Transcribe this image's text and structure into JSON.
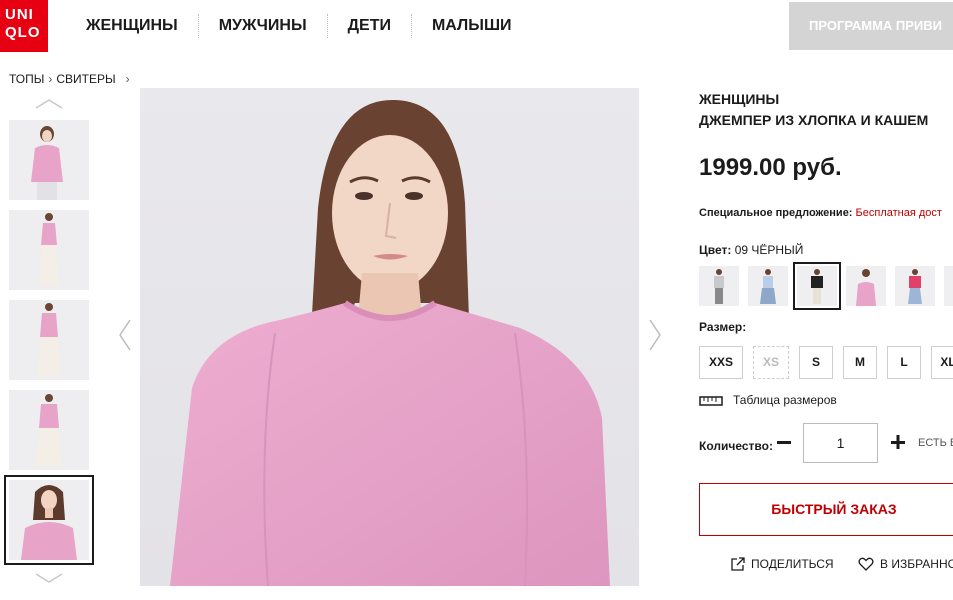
{
  "logo": {
    "line1": "UNI",
    "line2": "QLO",
    "color": "#e60012"
  },
  "nav": {
    "items": [
      "ЖЕНЩИНЫ",
      "МУЖЧИНЫ",
      "ДЕТИ",
      "МАЛЫШИ"
    ]
  },
  "promo": {
    "label": "ПРОГРАММА ПРИВИ"
  },
  "breadcrumb": {
    "items": [
      "ТОПЫ",
      "СВИТЕРЫ"
    ]
  },
  "thumbnails": {
    "count": 5,
    "selected_index": 4
  },
  "product": {
    "category": "ЖЕНЩИНЫ",
    "name": "ДЖЕМПЕР ИЗ ХЛОПКА И КАШЕМ",
    "price": "1999.00 руб.",
    "special_label": "Специальное предложение:",
    "special_value": "Бесплатная дост",
    "color_label": "Цвет:",
    "color_value": "09 ЧЁРНЫЙ",
    "size_label": "Размер:",
    "sizes": [
      "XXS",
      "XS",
      "S",
      "M",
      "L",
      "XL"
    ],
    "size_chart_label": "Таблица размеров",
    "qty_label": "Количество:",
    "qty_value": "1",
    "stock_text": "ЕСТЬ В",
    "quick_order": "БЫСТРЫЙ ЗАКАЗ",
    "share": "ПОДЕЛИТЬСЯ",
    "favorite": "В ИЗБРАННО"
  },
  "colors": {
    "accent": "#c00000",
    "sweater_pink": "#e8a3c8",
    "promo_bg": "#d4d4d4"
  }
}
